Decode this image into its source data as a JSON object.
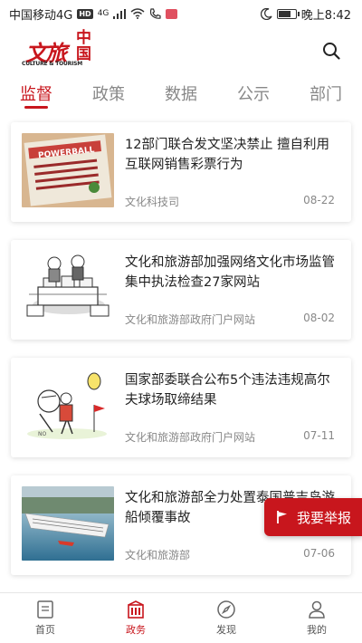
{
  "status_bar": {
    "carrier": "中国移动4G",
    "hd_badge": "HD",
    "network_type": "4G",
    "time": "晚上8:42",
    "battery_level": 0.8
  },
  "header": {
    "logo_cn_left": "文旅",
    "logo_cn_right": "中国",
    "logo_en": "CULTURE & TOURISM",
    "search_icon": "search-icon"
  },
  "tabs": [
    {
      "label": "监督",
      "active": true
    },
    {
      "label": "政策",
      "active": false
    },
    {
      "label": "数据",
      "active": false
    },
    {
      "label": "公示",
      "active": false
    },
    {
      "label": "部门",
      "active": false
    }
  ],
  "news": [
    {
      "title": "12部门联合发文坚决禁止 擅自利用互联网销售彩票行为",
      "source": "文化科技司",
      "date": "08-22",
      "thumb": "lottery-ticket-image"
    },
    {
      "title": "文化和旅游部加强网络文化市场监管集中执法检查27家网站",
      "source": "文化和旅游部政府门户网站",
      "date": "08-02",
      "thumb": "cartoon-officials-image"
    },
    {
      "title": "国家部委联合公布5个违法违规高尔夫球场取缔结果",
      "source": "文化和旅游部政府门户网站",
      "date": "07-11",
      "thumb": "cartoon-golf-image"
    },
    {
      "title": "文化和旅游部全力处置泰国普吉岛游船倾覆事故",
      "source": "文化和旅游部",
      "date": "07-06",
      "thumb": "capsized-ship-image"
    }
  ],
  "report_button": {
    "label": "我要举报",
    "icon": "flag-icon"
  },
  "bottom_nav": [
    {
      "label": "首页",
      "icon": "document-icon",
      "active": false
    },
    {
      "label": "政务",
      "icon": "building-icon",
      "active": true
    },
    {
      "label": "发现",
      "icon": "compass-icon",
      "active": false
    },
    {
      "label": "我的",
      "icon": "person-icon",
      "active": false
    }
  ],
  "colors": {
    "accent": "#c8161d",
    "muted_text": "#888888",
    "title_text": "#222222"
  }
}
